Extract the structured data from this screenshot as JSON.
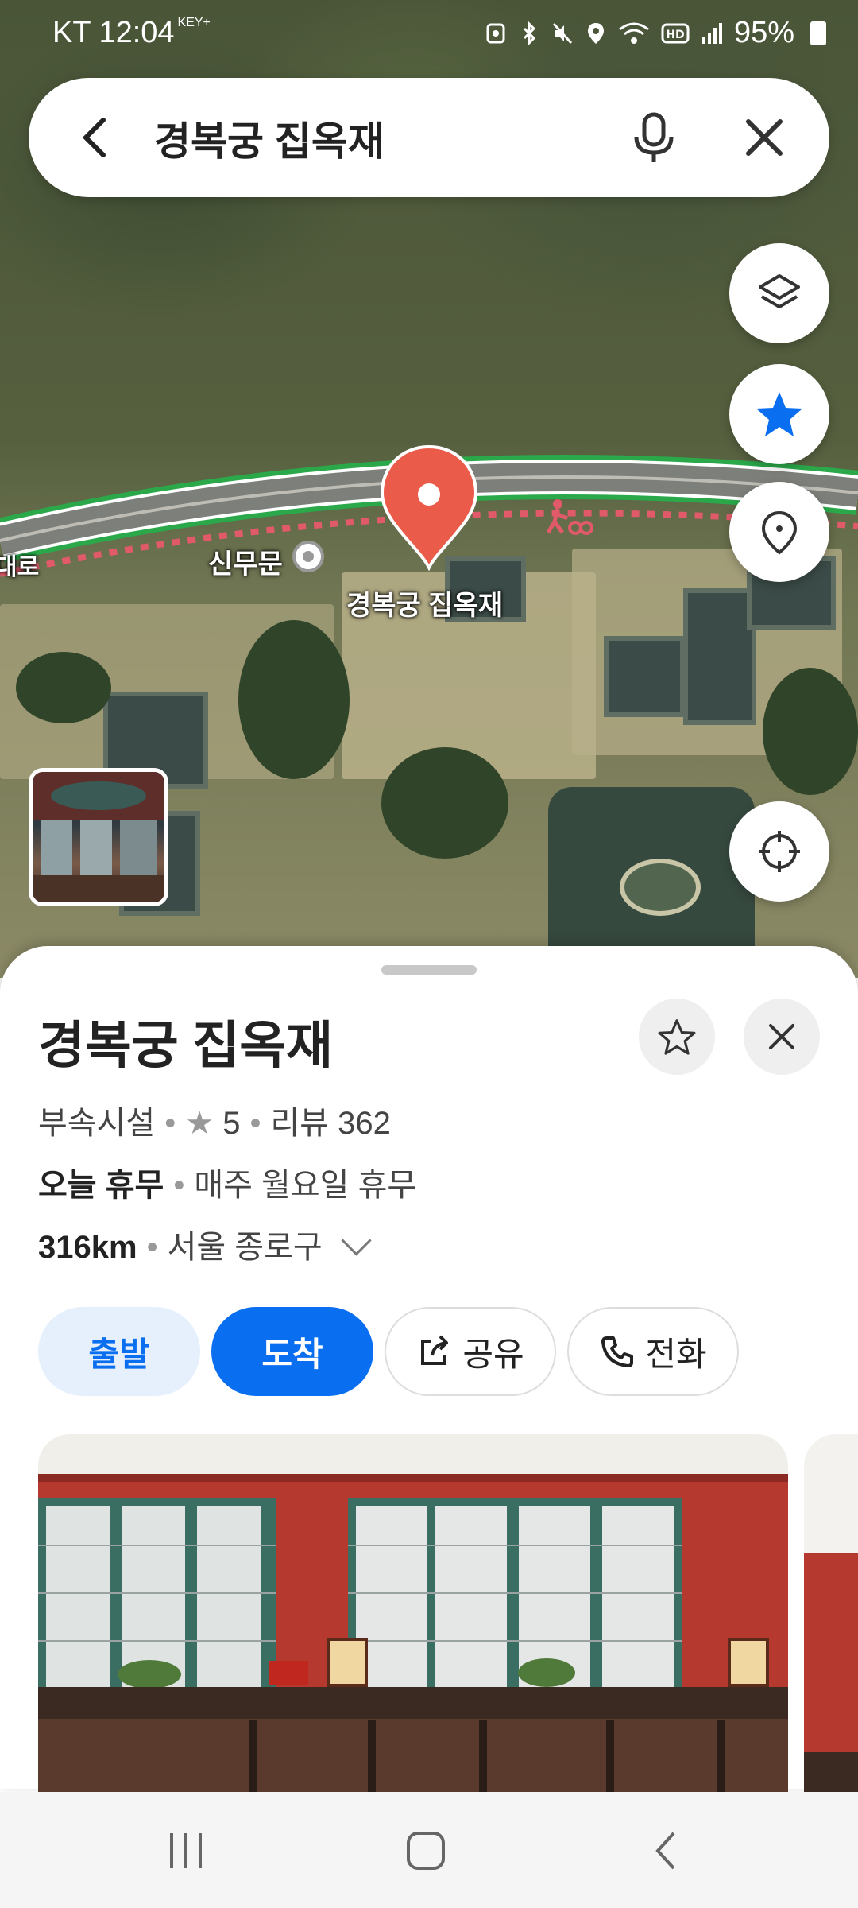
{
  "status_bar": {
    "time": "12:04",
    "carrier": "KT",
    "key_label": "KEY+",
    "battery": "95%"
  },
  "search": {
    "query": "경복궁 집옥재"
  },
  "map": {
    "labels": {
      "gate": "신무문",
      "place": "경복궁 집옥재",
      "road": "대로"
    },
    "pin_color": "#ea5b4a"
  },
  "place": {
    "title": "경복궁 집옥재",
    "category": "부속시설",
    "rating": "5",
    "reviews": "리뷰 362",
    "hours_status": "오늘 휴무",
    "hours_note": "매주 월요일 휴무",
    "distance": "316km",
    "region": "서울 종로구"
  },
  "actions": {
    "depart": "출발",
    "arrive": "도착",
    "share": "공유",
    "call": "전화"
  },
  "colors": {
    "accent": "#0a6ef0",
    "accent_light": "#e6f0fd"
  }
}
